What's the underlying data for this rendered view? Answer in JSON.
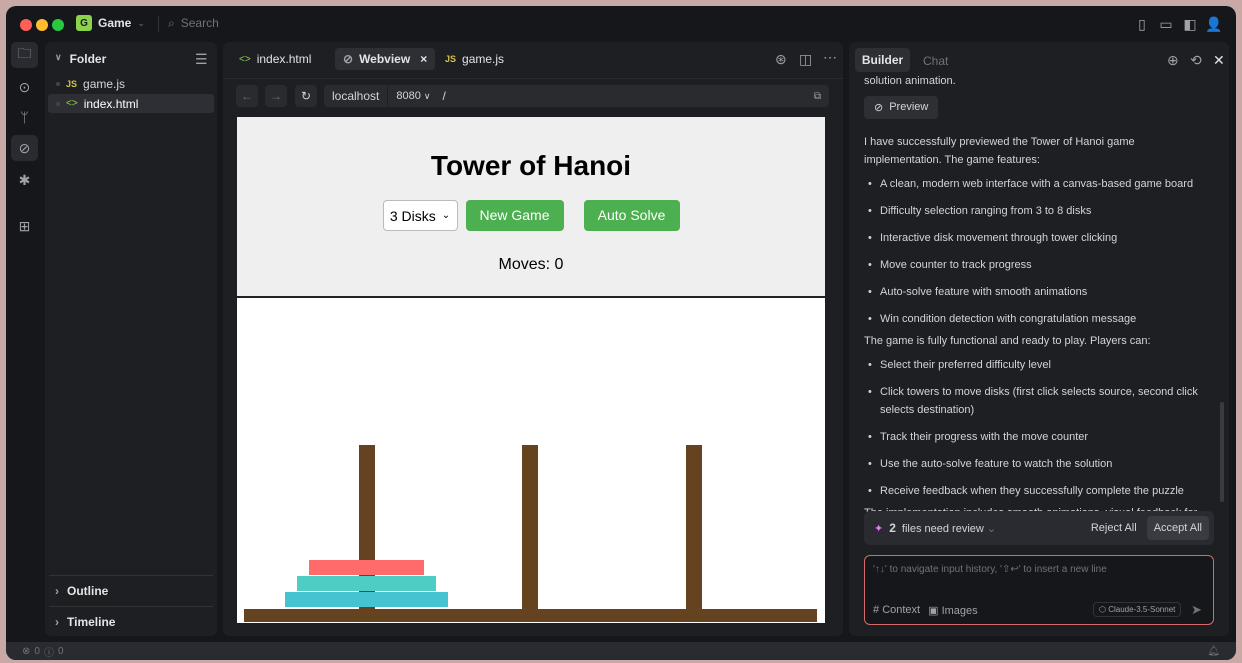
{
  "titlebar": {
    "project_initial": "G",
    "project": "Game",
    "search_placeholder": "Search"
  },
  "explorer": {
    "folder": "Folder",
    "files": [
      {
        "icon": "JS",
        "name": "game.js"
      },
      {
        "icon": "<>",
        "name": "index.html"
      }
    ],
    "outline": "Outline",
    "timeline": "Timeline"
  },
  "editor": {
    "tabs": [
      {
        "icon": "<>",
        "label": "index.html"
      },
      {
        "label": "Webview"
      },
      {
        "icon": "JS",
        "label": "game.js"
      }
    ],
    "url": {
      "host": "localhost",
      "port": "8080",
      "path": "/"
    }
  },
  "game": {
    "title": "Tower of Hanoi",
    "difficulty": "3 Disks",
    "new_game": "New Game",
    "auto_solve": "Auto Solve",
    "moves": "Moves: 0",
    "colors": {
      "button": "#4caf50",
      "pole": "#654321",
      "disk_small": "#ff6b6b",
      "disk_medium": "#4ecdc4",
      "disk_large": "#45b7d1"
    }
  },
  "assistant": {
    "tabs": [
      "Builder",
      "Chat"
    ],
    "prev_text": "solution animation.",
    "preview": "Preview",
    "intro": "I have successfully previewed the Tower of Hanoi game implementation. The game features:",
    "features": [
      "A clean, modern web interface with a canvas-based game board",
      "Difficulty selection ranging from 3 to 8 disks",
      "Interactive disk movement through tower clicking",
      "Move counter to track progress",
      "Auto-solve feature with smooth animations",
      "Win condition detection with congratulation message"
    ],
    "players_intro": "The game is fully functional and ready to play. Players can:",
    "player_items": [
      "Select their preferred difficulty level",
      "Click towers to move disks (first click selects source, second click selects destination)",
      "Track their progress with the move counter",
      "Use the auto-solve feature to watch the solution",
      "Receive feedback when they successfully complete the puzzle"
    ],
    "summary": "The implementation includes smooth animations, visual feedback for selected towers, and proper game state management.",
    "review": {
      "count": "2",
      "label": "files need review",
      "reject": "Reject All",
      "accept": "Accept All"
    },
    "input_placeholder": "'↑↓' to navigate input history, '⇧↩' to insert a new line",
    "context": "Context",
    "images": "Images",
    "model": "Claude-3.5-Sonnet"
  },
  "statusbar": {
    "errors": "0",
    "warnings": "0"
  }
}
